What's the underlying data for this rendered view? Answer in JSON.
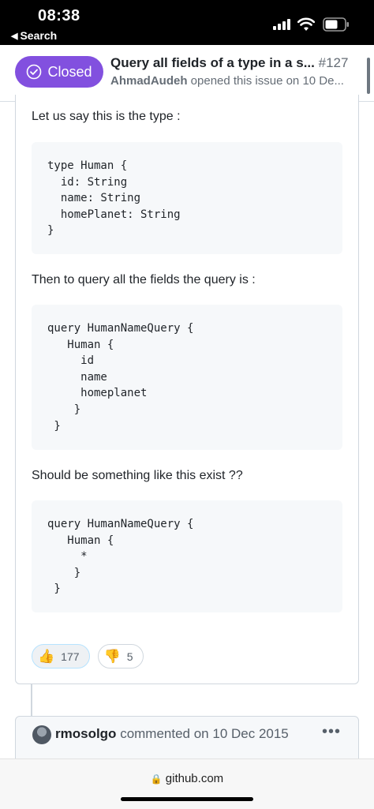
{
  "status_bar": {
    "time": "08:38",
    "back_label": "Search"
  },
  "issue": {
    "state": "Closed",
    "title": "Query all fields of a type in a s...",
    "number": "#127",
    "author": "AhmadAudeh",
    "meta": "opened this issue on 10 De..."
  },
  "comment": {
    "para1": "Let us say this is the type :",
    "code1": "type Human {\n  id: String\n  name: String\n  homePlanet: String\n}",
    "para2": "Then to query all the fields the query is :",
    "code2": "query HumanNameQuery {\n   Human {\n     id\n     name\n     homeplanet\n    }\n }",
    "para3": "Should be something like this exist ??",
    "code3": "query HumanNameQuery {\n   Human {\n     *\n    }\n }",
    "reactions": [
      {
        "icon": "thumbs-up",
        "emoji": "👍",
        "count": "177"
      },
      {
        "icon": "thumbs-down",
        "emoji": "👎",
        "count": "5"
      }
    ]
  },
  "next_comment": {
    "author": "rmosolgo",
    "text": "commented on 10 Dec 2015",
    "menu": "•••"
  },
  "browser": {
    "url": "github.com"
  },
  "colors": {
    "closed_purple": "#8250df",
    "code_bg": "#f6f8fa"
  }
}
